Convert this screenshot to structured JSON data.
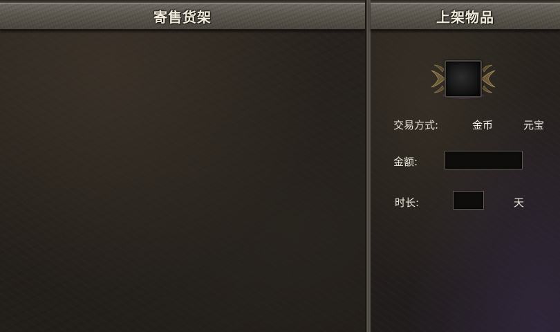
{
  "left_panel": {
    "title": "寄售货架"
  },
  "right_panel": {
    "title": "上架物品",
    "item_slot": {
      "icon": "empty-item-slot"
    },
    "trade_method": {
      "label": "交易方式:",
      "options": [
        "金币",
        "元宝"
      ]
    },
    "amount": {
      "label": "金额:",
      "value": ""
    },
    "duration": {
      "label": "时长:",
      "value": "",
      "unit": "天"
    }
  }
}
